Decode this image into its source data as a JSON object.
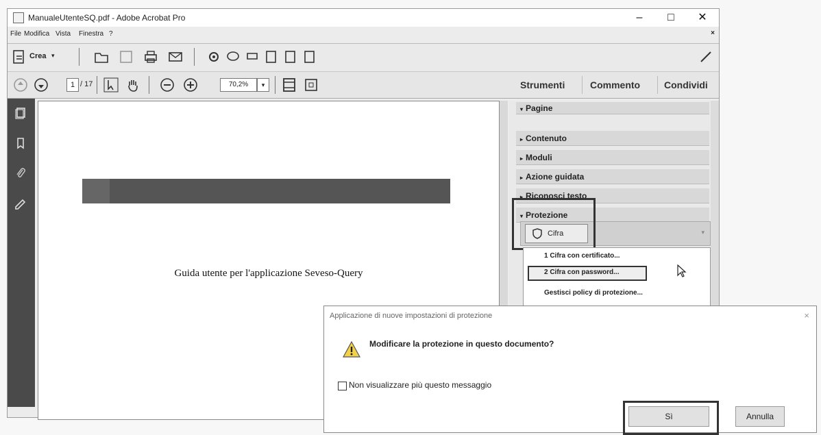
{
  "window": {
    "title": "ManualeUtenteSQ.pdf - Adobe Acrobat Pro",
    "minimize": "–",
    "maximize": "□",
    "close": "✕"
  },
  "menubar": {
    "items": [
      "File",
      "Modifica",
      "Vista",
      "Finestra",
      "?"
    ],
    "close": "×"
  },
  "toolbar": {
    "create_label": "Crea",
    "page_current": "1",
    "page_total": "/ 17",
    "zoom": "70,2%",
    "tabs": [
      "Strumenti",
      "Commento",
      "Condividi"
    ]
  },
  "document": {
    "text": "Guida utente per l'applicazione Seveso-Query"
  },
  "panel": {
    "items": [
      "Pagine",
      "Contenuto",
      "Moduli",
      "Azione guidata",
      "Riconosci testo",
      "Protezione"
    ],
    "cifra_button": "Cifra",
    "menu": [
      "1 Cifra con certificato...",
      "2 Cifra con password...",
      "Gestisci policy di protezione..."
    ]
  },
  "dialog": {
    "title": "Applicazione di nuove impostazioni di protezione",
    "close": "×",
    "question": "Modificare la protezione in questo documento?",
    "checkbox_label": "Non visualizzare più questo messaggio",
    "yes": "Sì",
    "cancel": "Annulla"
  }
}
